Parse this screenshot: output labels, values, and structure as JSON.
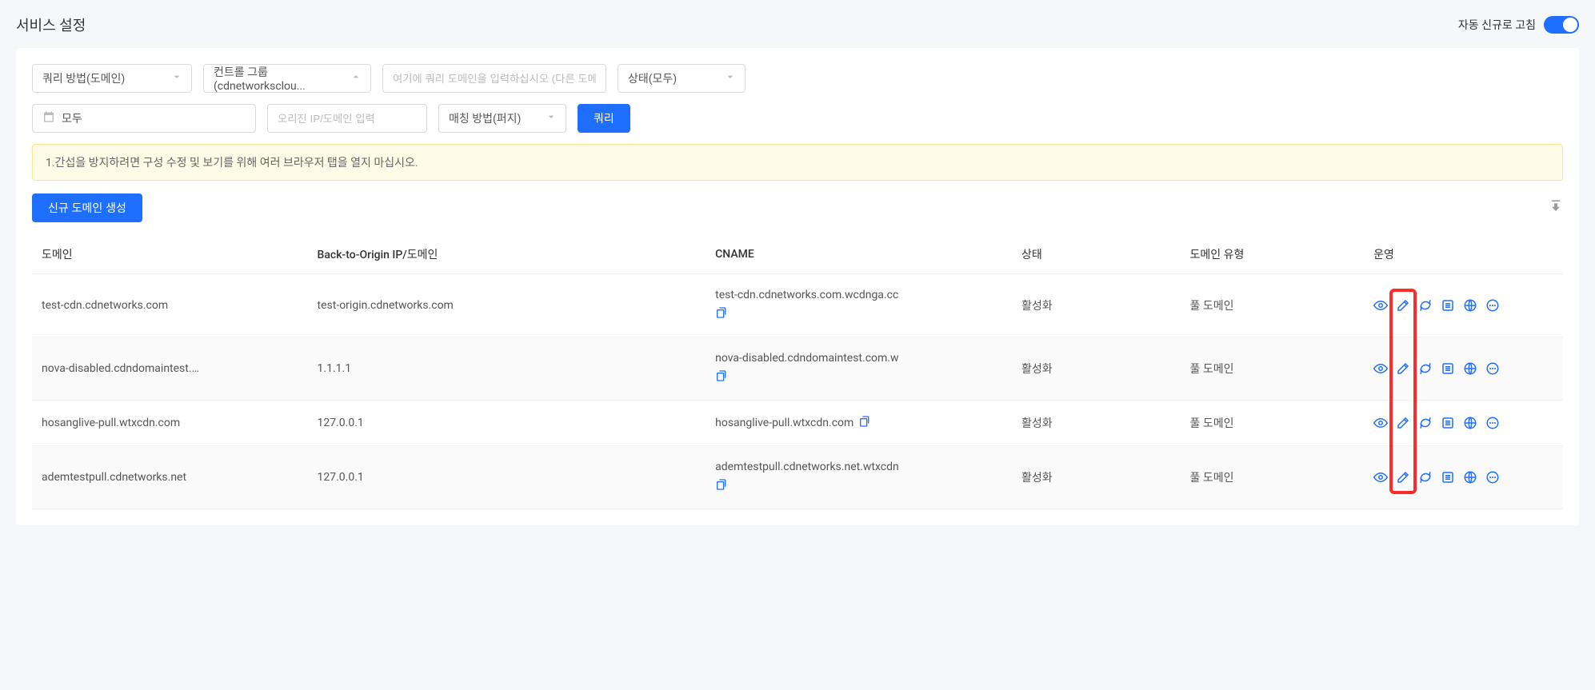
{
  "header": {
    "title": "서비스 설정",
    "auto_refresh_label": "자동 신규로 고침"
  },
  "filters": {
    "query_method": "쿼리 방법(도메인)",
    "control_group": "컨트롤 그룹(cdnetworksclou...",
    "query_domain_placeholder": "여기에 쿼리 도메인을 입력하십시오 (다른 도메인",
    "status": "상태(모두)",
    "date_all": "모두",
    "origin_placeholder": "오리진 IP/도메인 입력",
    "matching_method": "매칭 방법(퍼지)",
    "query_button": "쿼리"
  },
  "alert": "1.간섭을 방지하려면 구성 수정 및 보기를 위해 여러 브라우저 탭을 열지 마십시오.",
  "actions": {
    "create_domain": "신규 도메인 생성"
  },
  "table": {
    "headers": {
      "domain": "도메인",
      "origin": "Back-to-Origin IP/도메인",
      "cname": "CNAME",
      "status": "상태",
      "type": "도메인 유형",
      "ops": "운영"
    },
    "rows": [
      {
        "domain": "test-cdn.cdnetworks.com",
        "origin": "test-origin.cdnetworks.com",
        "cname": "test-cdn.cdnetworks.com.wcdnga.cc",
        "cname_wrap": true,
        "status": "활성화",
        "type": "풀 도메인"
      },
      {
        "domain": "nova-disabled.cdndomaintest.c...",
        "origin": "1.1.1.1",
        "cname": "nova-disabled.cdndomaintest.com.w",
        "cname_wrap": true,
        "status": "활성화",
        "type": "풀 도메인"
      },
      {
        "domain": "hosanglive-pull.wtxcdn.com",
        "origin": "127.0.0.1",
        "cname": "hosanglive-pull.wtxcdn.com",
        "cname_wrap": false,
        "status": "활성화",
        "type": "풀 도메인"
      },
      {
        "domain": "ademtestpull.cdnetworks.net",
        "origin": "127.0.0.1",
        "cname": "ademtestpull.cdnetworks.net.wtxcdn",
        "cname_wrap": true,
        "status": "활성화",
        "type": "풀 도메인"
      }
    ]
  }
}
